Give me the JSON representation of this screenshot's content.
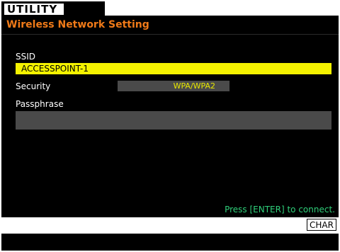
{
  "tab": {
    "label": "UTILITY"
  },
  "header": {
    "title": "Wireless Network Setting"
  },
  "form": {
    "ssid_label": "SSID",
    "ssid_value": "ACCESSPOINT-1",
    "security_label": "Security",
    "security_value": "WPA/WPA2",
    "passphrase_label": "Passphrase",
    "passphrase_value": ""
  },
  "hint": "Press [ENTER] to connect.",
  "buttons": {
    "char": "CHAR"
  },
  "colors": {
    "title": "#f07a18",
    "selected_field": "#f4f200",
    "field_bg": "#4a4a4a",
    "security_text": "#e8e800",
    "hint_text": "#2fcf7a"
  }
}
